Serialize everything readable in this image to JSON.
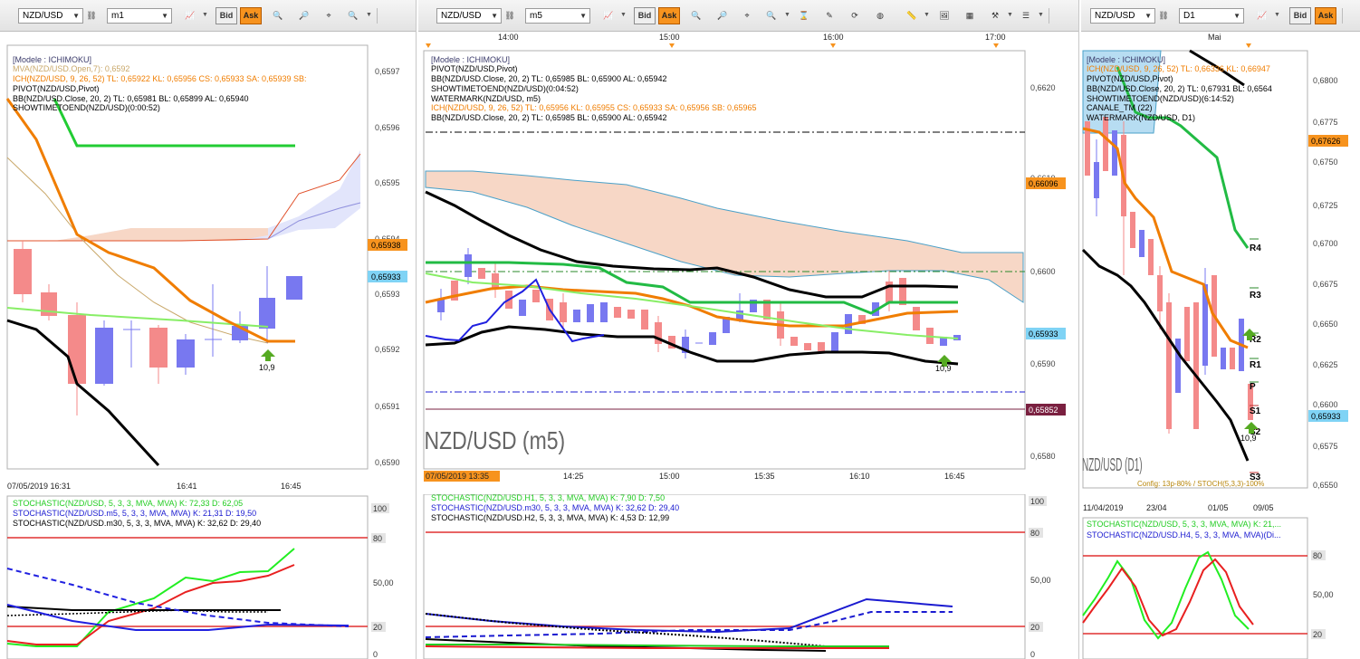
{
  "windows": [
    {
      "id": "left",
      "symbol": "NZD/USD",
      "timeframe": "m1",
      "buttons": {
        "bid": "Bid",
        "ask": "Ask"
      },
      "main": {
        "legend": [
          {
            "text": "[Modele : ICHIMOKU]",
            "color": "#3a3a6a"
          },
          {
            "text": "MVA(NZD/USD.Open,7): 0,6592",
            "color": "#c9a86a"
          },
          {
            "text": "ICH(NZD/USD, 9, 26, 52)  TL: 0,65922  KL: 0,65956  CS: 0,65933  SA: 0,65939  SB:",
            "color": "#f07d00"
          },
          {
            "text": "PIVOT(NZD/USD,Pivot)",
            "color": "#000000"
          },
          {
            "text": "BB(NZD/USD.Close, 20, 2)  TL: 0,65981  BL: 0,65899  AL: 0,65940",
            "color": "#000000"
          },
          {
            "text": "SHOWTIMETOEND(NZD/USD)(0:00:52)",
            "color": "#000000"
          }
        ],
        "y_ticks": [
          "0,6597",
          "0,6596",
          "0,6595",
          "0,6594",
          "0,6593",
          "0,6592",
          "0,6591",
          "0,6590"
        ],
        "price_tags": [
          {
            "text": "0,65938",
            "bg": "#f7931e"
          },
          {
            "text": "0,65933",
            "bg": "#7fd3f5"
          }
        ],
        "x_labels": [
          "07/05/2019 16:31",
          "16:41",
          "16:45"
        ],
        "marker": "10,9"
      },
      "sub": {
        "legend": [
          {
            "text": "STOCHASTIC(NZD/USD, 5, 3, 3, MVA, MVA)  K: 72,33  D: 62,05",
            "color": "#22cc22"
          },
          {
            "text": "STOCHASTIC(NZD/USD.m5, 5, 3, 3, MVA, MVA)  K: 21,31  D: 19,50",
            "color": "#1a1ad0"
          },
          {
            "text": "STOCHASTIC(NZD/USD.m30, 5, 3, 3, MVA, MVA)  K: 32,62  D: 29,40",
            "color": "#000000"
          }
        ],
        "y_ticks": [
          "100",
          "80",
          "50,00",
          "20",
          "0"
        ]
      }
    },
    {
      "id": "middle",
      "symbol": "NZD/USD",
      "timeframe": "m5",
      "buttons": {
        "bid": "Bid",
        "ask": "Ask"
      },
      "top_times": [
        "14:00",
        "15:00",
        "16:00",
        "17:00"
      ],
      "main": {
        "legend": [
          {
            "text": "[Modele : ICHIMOKU]",
            "color": "#3a3a6a"
          },
          {
            "text": "PIVOT(NZD/USD,Pivot)",
            "color": "#000000"
          },
          {
            "text": "BB(NZD/USD.Close, 20, 2)  TL: 0,65985  BL: 0,65900  AL: 0,65942",
            "color": "#000000"
          },
          {
            "text": "SHOWTIMETOEND(NZD/USD)(0:04:52)",
            "color": "#000000"
          },
          {
            "text": "WATERMARK(NZD/USD, m5)",
            "color": "#000000"
          },
          {
            "text": "ICH(NZD/USD, 9, 26, 52)  TL: 0,65956  KL: 0,65955  CS: 0,65933  SA: 0,65956  SB: 0,65965",
            "color": "#f07d00"
          },
          {
            "text": "BB(NZD/USD.Close, 20, 2)  TL: 0,65985  BL: 0,65900  AL: 0,65942",
            "color": "#000000"
          }
        ],
        "y_ticks": [
          "0,6620",
          "0,6610",
          "0,6600",
          "0,6590",
          "0,6580"
        ],
        "price_tags": [
          {
            "text": "0,66096",
            "bg": "#f7931e"
          },
          {
            "text": "0,65933",
            "bg": "#7fd3f5"
          },
          {
            "text": "0,65852",
            "bg": "#7a2040"
          }
        ],
        "x_labels": [
          "07/05/2019 13:35",
          "14:25",
          "15:00",
          "15:35",
          "16:10",
          "16:45"
        ],
        "watermark": "NZD/USD (m5)",
        "marker": "10,9"
      },
      "sub": {
        "legend": [
          {
            "text": "STOCHASTIC(NZD/USD.H1, 5, 3, 3, MVA, MVA)  K: 7,90  D: 7,50",
            "color": "#22cc22"
          },
          {
            "text": "STOCHASTIC(NZD/USD.m30, 5, 3, 3, MVA, MVA)  K: 32,62  D: 29,40",
            "color": "#1a1ad0"
          },
          {
            "text": "STOCHASTIC(NZD/USD.H2, 5, 3, 3, MVA, MVA)  K: 4,53  D: 12,99",
            "color": "#000000"
          }
        ],
        "y_ticks": [
          "100",
          "80",
          "50,00",
          "20",
          "0"
        ]
      }
    },
    {
      "id": "right",
      "symbol": "NZD/USD",
      "timeframe": "D1",
      "buttons": {
        "bid": "Bid",
        "ask": "Ask"
      },
      "top_times": [
        "Mai"
      ],
      "main": {
        "legend": [
          {
            "text": "[Modele : ICHIMOKU]",
            "color": "#3a3a6a"
          },
          {
            "text": "ICH(NZD/USD, 9, 26, 52)  TL: 0,66336  KL: 0,66947",
            "color": "#f07d00"
          },
          {
            "text": "PIVOT(NZD/USD,Pivot)",
            "color": "#000000"
          },
          {
            "text": "BB(NZD/USD.Close, 20, 2)  TL: 0,67931  BL: 0,6564",
            "color": "#000000"
          },
          {
            "text": "SHOWTIMETOEND(NZD/USD)(6:14:52)",
            "color": "#000000"
          },
          {
            "text": "CANALE_TM (22)",
            "color": "#000000"
          },
          {
            "text": "WATERMARK(NZD/USD, D1)",
            "color": "#000000"
          }
        ],
        "y_ticks": [
          "0,6800",
          "0,6775",
          "0,6750",
          "0,6725",
          "0,6700",
          "0,6675",
          "0,6650",
          "0,6625",
          "0,6600",
          "0,6575",
          "0,6550"
        ],
        "price_tags": [
          {
            "text": "0,67626",
            "bg": "#f7931e"
          },
          {
            "text": "0,65933",
            "bg": "#7fd3f5"
          }
        ],
        "pivot_labels": [
          "R4",
          "R3",
          "R2",
          "R1",
          "P",
          "S1",
          "S2",
          "S3"
        ],
        "x_labels": [
          "11/04/2019",
          "23/04",
          "01/05",
          "09/05"
        ],
        "watermark": "NZD/USD (D1)",
        "config": "Config: 13p-80% / STOCH(5,3,3)-100%",
        "marker": "10,9"
      },
      "sub": {
        "legend": [
          {
            "text": "STOCHASTIC(NZD/USD, 5, 3, 3, MVA, MVA)  K: 21,...",
            "color": "#22cc22"
          },
          {
            "text": "STOCHASTIC(NZD/USD.H4, 5, 3, 3, MVA, MVA)(Di...",
            "color": "#1a1ad0"
          }
        ],
        "y_ticks": [
          "80",
          "50,00",
          "20"
        ]
      }
    }
  ]
}
